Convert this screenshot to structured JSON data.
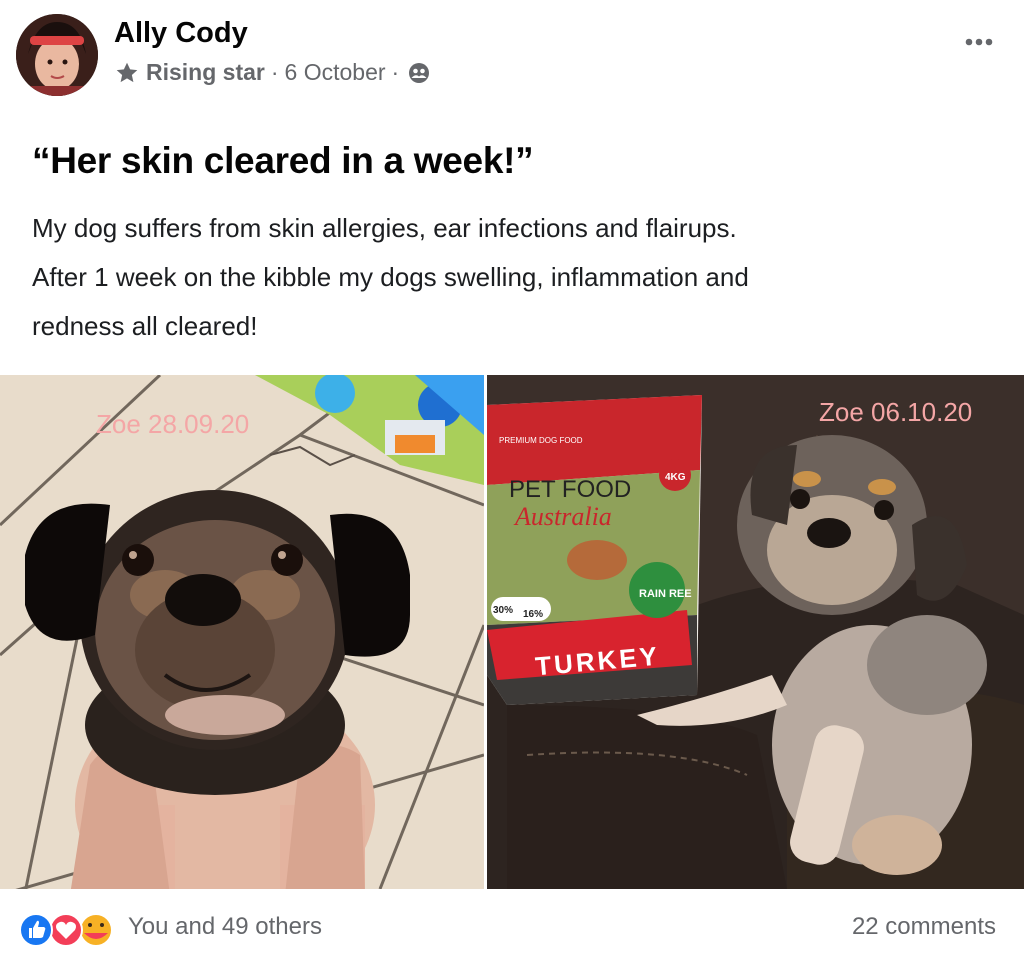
{
  "post": {
    "author": "Ally Cody",
    "badge": "Rising star",
    "separator": "·",
    "date": "6 October",
    "audience_icon": "friends-icon",
    "more_icon": "more-options-icon",
    "headline": "“Her skin cleared in a week!”",
    "body_lines": [
      "My dog suffers from skin allergies, ear infections and flairups.",
      "After 1 week on the kibble my dogs swelling, inflammation and",
      "redness all cleared!"
    ]
  },
  "photos": {
    "left": {
      "watermark": "Zoe 28.09.20"
    },
    "right": {
      "watermark": "Zoe 06.10.20",
      "bag": {
        "small_text": "PREMIUM DOG FOOD",
        "brand_line1": "PET FOOD",
        "brand_line2": "Australia",
        "weight": "4KG",
        "stat_a": "30%",
        "stat_b": "16%",
        "badge": "RAIN REE",
        "flavor": "TURKEY"
      }
    }
  },
  "footer": {
    "reaction_icons": [
      "like-icon",
      "love-icon",
      "care-icon"
    ],
    "reactions_text": "You and 49 others",
    "comments_text": "22 comments"
  },
  "colors": {
    "like_blue": "#1877f2",
    "love_red": "#f33e58",
    "care_yellow": "#f7b125",
    "secondary_text": "#65676b"
  }
}
